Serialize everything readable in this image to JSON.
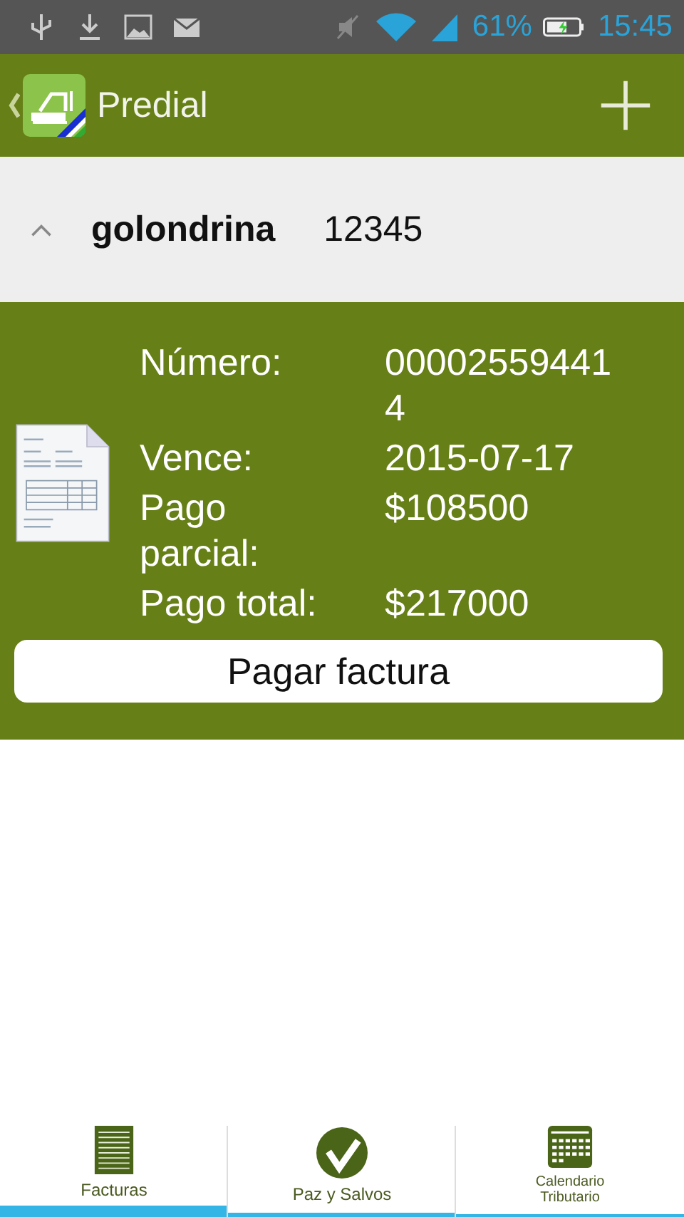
{
  "status_bar": {
    "battery": "61%",
    "time": "15:45"
  },
  "app_bar": {
    "title": "Predial"
  },
  "group": {
    "name": "golondrina",
    "code": "12345",
    "expanded": true
  },
  "invoice": {
    "fields": [
      {
        "label": "Número:",
        "value": "000025594414"
      },
      {
        "label": "Vence:",
        "value": "2015-07-17"
      },
      {
        "label": "Pago parcial:",
        "value": "$108500"
      },
      {
        "label": "Pago total:",
        "value": "$217000"
      }
    ],
    "button": "Pagar factura"
  },
  "tabs": [
    {
      "label": "Facturas",
      "kind": "list",
      "selected": true
    },
    {
      "label": "Paz y Salvos",
      "kind": "check",
      "selected": false
    },
    {
      "label": "Calendario Tributario",
      "kind": "calendar",
      "selected": false
    }
  ]
}
